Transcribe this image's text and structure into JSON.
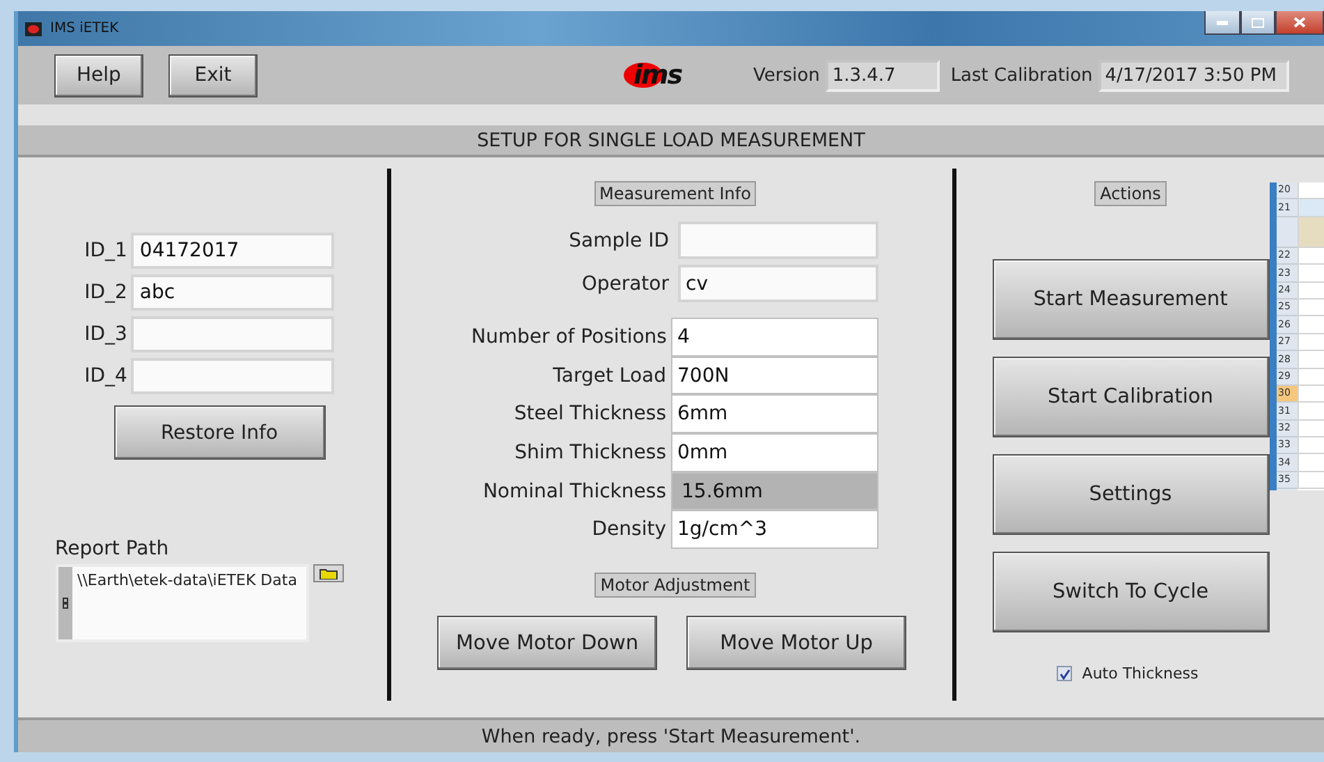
{
  "window": {
    "title": "IMS iETEK"
  },
  "toolbar": {
    "buttons": [
      "Help",
      "Exit"
    ],
    "logo": "ims",
    "version": {
      "label": "Version",
      "value": "1.3.4.7"
    },
    "last_calibration": {
      "label": "Last Calibration",
      "value": "4/17/2017 3:50 PM"
    }
  },
  "heading": "SETUP FOR SINGLE LOAD MEASUREMENT",
  "ids": [
    {
      "label": "ID_1",
      "value": "04172017"
    },
    {
      "label": "ID_2",
      "value": "abc"
    },
    {
      "label": "ID_3"
    },
    {
      "label": "ID_4"
    }
  ],
  "restore_button": "Restore Info",
  "report_path": {
    "label": "Report Path",
    "value": "\\\\Earth\\etek-data\\iETEK Data"
  },
  "measurement_info": {
    "title": "Measurement Info",
    "ids": [
      {
        "label": "Sample ID"
      },
      {
        "label": "Operator",
        "value": "cv"
      }
    ],
    "params": [
      {
        "label": "Number of Positions",
        "value": "4",
        "readonly": false
      },
      {
        "label": "Target Load",
        "value": "700N",
        "readonly": false
      },
      {
        "label": "Steel Thickness",
        "value": "6mm",
        "readonly": false
      },
      {
        "label": "Shim Thickness",
        "value": "0mm",
        "readonly": false
      },
      {
        "label": "Nominal Thickness",
        "value": "15.6mm",
        "readonly": true
      },
      {
        "label": "Density",
        "value": "1g/cm^3",
        "readonly": false
      }
    ]
  },
  "motor": {
    "title": "Motor Adjustment",
    "buttons": [
      "Move Motor Down",
      "Move Motor Up"
    ]
  },
  "actions": {
    "title": "Actions",
    "buttons": [
      "Start Measurement",
      "Start Calibration",
      "Settings",
      "Switch To Cycle"
    ],
    "auto_thickness": {
      "label": "Auto Thickness",
      "checked": true
    }
  },
  "status_bar": "When ready, press 'Start Measurement'.",
  "background_sheet": {
    "rows": [
      {
        "label": "20",
        "selected": false
      },
      {
        "label": "21",
        "selected": false
      },
      {
        "selected": false
      },
      {
        "label": "22",
        "selected": false
      },
      {
        "label": "23",
        "selected": false
      },
      {
        "label": "24",
        "selected": false
      },
      {
        "label": "25",
        "selected": false
      },
      {
        "label": "26",
        "selected": false
      },
      {
        "label": "27",
        "selected": false
      },
      {
        "label": "28",
        "selected": false
      },
      {
        "label": "29",
        "selected": false
      },
      {
        "label": "30",
        "selected": true
      },
      {
        "label": "31",
        "selected": false
      },
      {
        "label": "32",
        "selected": false
      },
      {
        "label": "33",
        "selected": false
      },
      {
        "label": "34",
        "selected": false
      },
      {
        "label": "35",
        "selected": false
      }
    ]
  }
}
